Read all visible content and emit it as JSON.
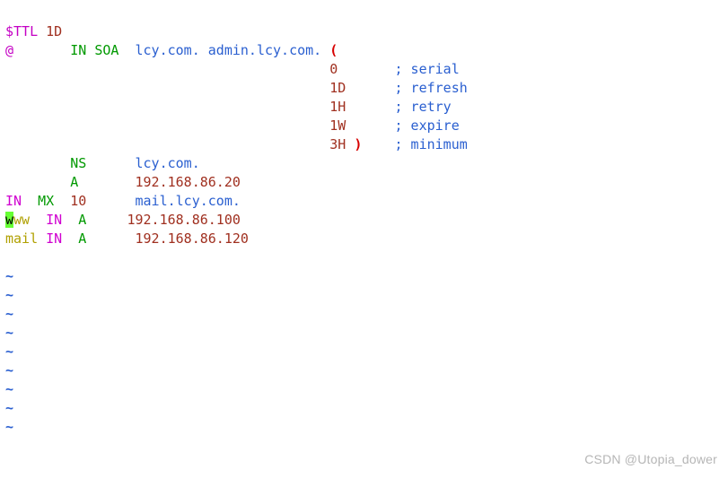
{
  "line1": {
    "ttl": "$TTL",
    "dur": "1D"
  },
  "line2": {
    "at": "@",
    "in": "IN",
    "soa": "SOA",
    "prim": "lcy.com.",
    "admin": "admin.lcy.com.",
    "paren": "("
  },
  "soa": {
    "serial_val": "0",
    "serial_sep": ";",
    "serial_lbl": "serial",
    "refresh_val": "1D",
    "refresh_sep": ";",
    "refresh_lbl": "refresh",
    "retry_val": "1H",
    "retry_sep": ";",
    "retry_lbl": "retry",
    "expire_val": "1W",
    "expire_sep": ";",
    "expire_lbl": "expire",
    "min_val": "3H",
    "min_close": ")",
    "min_sep": ";",
    "min_lbl": "minimum"
  },
  "ns": {
    "type": "NS",
    "val": "lcy.com."
  },
  "a1": {
    "type": "A",
    "val": "192.168.86.20"
  },
  "mx": {
    "in": "IN",
    "type": "MX",
    "pri": "10",
    "val": "mail.lcy.com."
  },
  "www": {
    "cur": "w",
    "rest": "ww",
    "in": "IN",
    "type": "A",
    "val": "192.168.86.100"
  },
  "mail": {
    "name": "mail",
    "in": "IN",
    "type": "A",
    "val": "192.168.86.120"
  },
  "tilde": "~",
  "watermark": "CSDN @Utopia_dower"
}
